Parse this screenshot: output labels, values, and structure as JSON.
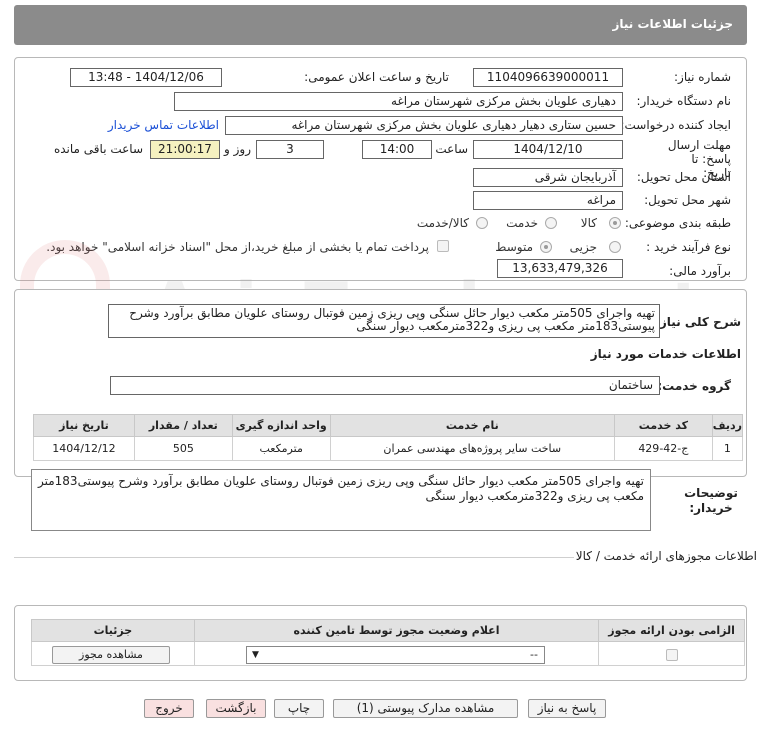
{
  "header": {
    "title": "جزئیات اطلاعات نیاز"
  },
  "fields": {
    "need_number_label": "شماره نیاز:",
    "need_number": "1104096639000011",
    "announce_label": "تاریخ و ساعت اعلان عمومی:",
    "announce_value": "1404/12/06 - 13:48",
    "buyer_org_label": "نام دستگاه خریدار:",
    "buyer_org": "دهیاری علویان بخش مرکزی شهرستان مراغه",
    "creator_label": "ایجاد کننده درخواست:",
    "creator": "حسین ستاری  دهیار دهیاری علویان بخش مرکزی شهرستان مراغه",
    "contact_link": "اطلاعات تماس خریدار",
    "deadline_label": "مهلت ارسال پاسخ: تا تاریخ:",
    "deadline_date": "1404/12/10",
    "time_label": "ساعت",
    "deadline_time": "14:00",
    "days_value": "3",
    "days_label": "روز و",
    "remaining_time": "21:00:17",
    "remaining_label": "ساعت باقی مانده",
    "province_label": "استان محل تحویل:",
    "province": "آذربایجان شرقی",
    "city_label": "شهر محل تحویل:",
    "city": "مراغه",
    "category_label": "طبقه بندی موضوعی:",
    "category_options": [
      "کالا",
      "خدمت",
      "کالا/خدمت"
    ],
    "process_label": "نوع فرآیند خرید :",
    "process_options": [
      "جزیی",
      "متوسط"
    ],
    "payment_note": "پرداخت تمام یا بخشی از مبلغ خرید،از محل \"اسناد خزانه اسلامی\" خواهد بود.",
    "estimate_label": "برآورد مالی:",
    "estimate": "13,633,479,326"
  },
  "description": {
    "label": "شرح کلی نیاز:",
    "text": "تهیه واجرای 505متر مکعب دیوار حائل سنگی وپی ریزی زمین فوتبال روستای علویان مطابق برآورد وشرح پیوستی183متر مکعب پی ریزی و322مترمکعب دیوار سنگی"
  },
  "services": {
    "section_title": "اطلاعات خدمات مورد نیاز",
    "group_label": "گروه خدمت:",
    "group_value": "ساختمان",
    "columns": [
      "ردیف",
      "کد خدمت",
      "نام خدمت",
      "واحد اندازه گیری",
      "تعداد / مقدار",
      "تاریخ نیاز"
    ],
    "rows": [
      {
        "row": "1",
        "code": "ج-42-429",
        "name": "ساخت سایر پروژه‌های مهندسی عمران",
        "unit": "مترمکعب",
        "qty": "505",
        "date": "1404/12/12"
      }
    ]
  },
  "buyer_notes": {
    "label": "توضیحات خریدار:",
    "text": "تهیه واجرای 505متر مکعب دیوار حائل سنگی وپی ریزی زمین فوتبال روستای علویان مطابق برآورد وشرح پیوستی183متر مکعب پی ریزی و322مترمکعب دیوار سنگی"
  },
  "permits": {
    "section_title": "اطلاعات مجوزهای ارائه خدمت / کالا",
    "columns": [
      "الزامی بودن ارائه مجوز",
      "اعلام وضعیت مجوز توسط تامین کننده",
      "جزئیات"
    ],
    "select_value": "--",
    "view_button": "مشاهده مجوز"
  },
  "buttons": {
    "reply": "پاسخ به نیاز",
    "attachments": "مشاهده مدارک پیوستی (1)",
    "print": "چاپ",
    "back": "بازگشت",
    "exit": "خروج"
  }
}
